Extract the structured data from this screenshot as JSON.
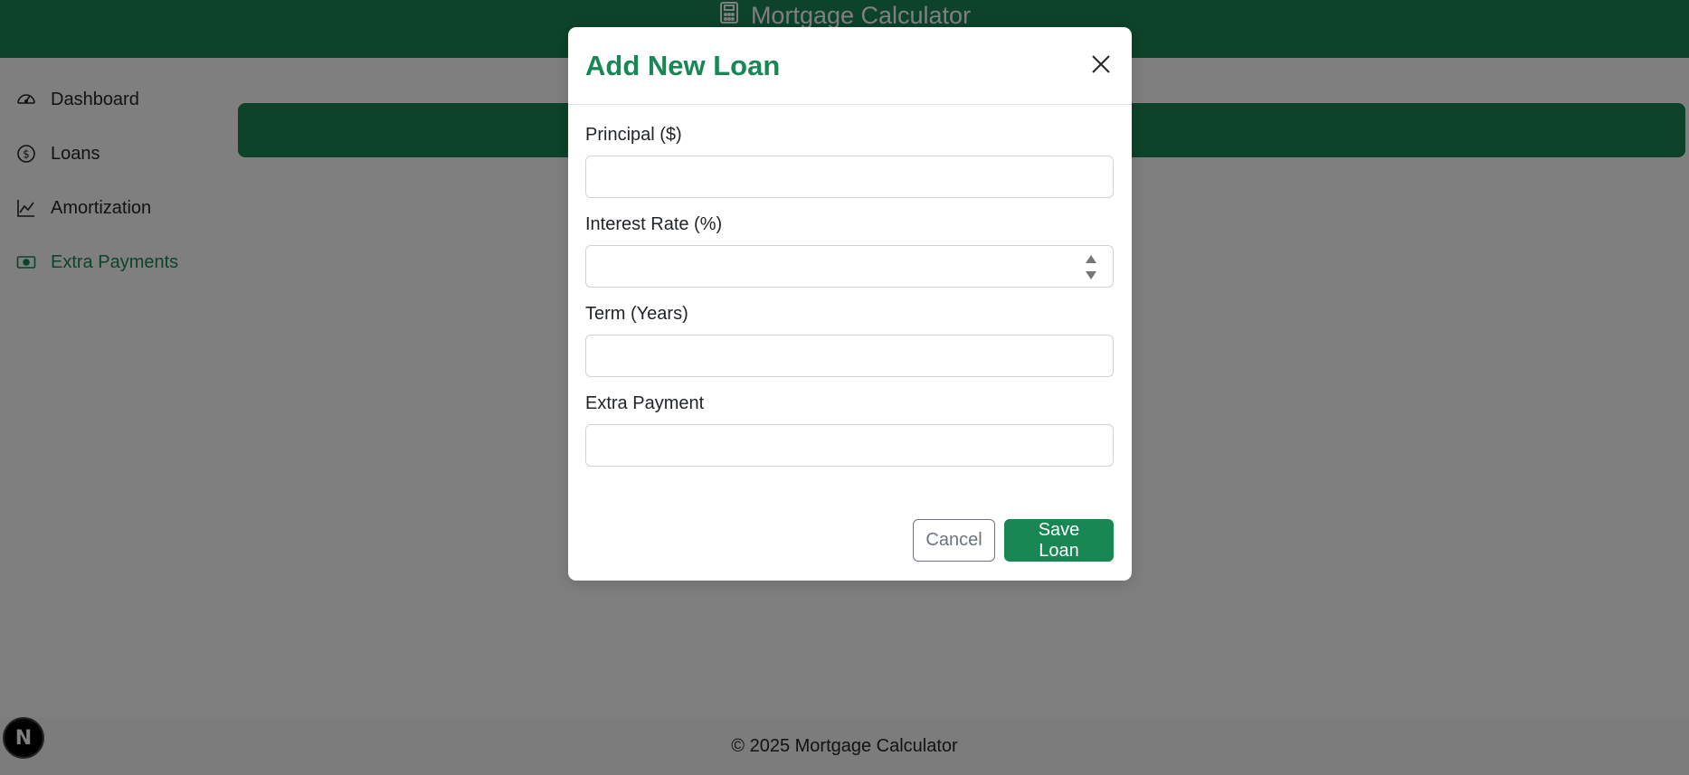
{
  "app": {
    "title": "Mortgage Calculator",
    "accent_color": "#198754"
  },
  "sidebar": {
    "items": [
      {
        "label": "Dashboard",
        "icon": "speedometer-icon",
        "active": false
      },
      {
        "label": "Loans",
        "icon": "dollar-circle-icon",
        "active": false
      },
      {
        "label": "Amortization",
        "icon": "line-chart-icon",
        "active": false
      },
      {
        "label": "Extra Payments",
        "icon": "cash-icon",
        "active": true
      }
    ]
  },
  "footer": {
    "text": "© 2025 Mortgage Calculator"
  },
  "dev_badge": {
    "label": "N"
  },
  "modal": {
    "title": "Add New Loan",
    "fields": [
      {
        "label": "Principal ($)",
        "value": "",
        "placeholder": ""
      },
      {
        "label": "Interest Rate (%)",
        "value": "",
        "placeholder": ""
      },
      {
        "label": "Term (Years)",
        "value": "",
        "placeholder": ""
      },
      {
        "label": "Extra Payment",
        "value": "",
        "placeholder": ""
      }
    ],
    "cancel_label": "Cancel",
    "save_label": "Save Loan"
  }
}
